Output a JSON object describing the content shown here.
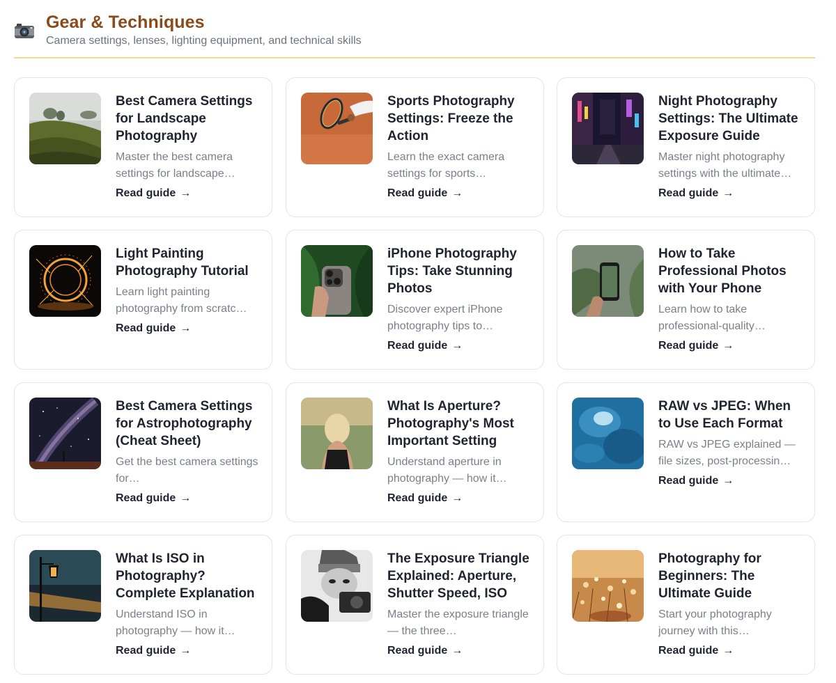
{
  "header": {
    "icon": "camera-icon",
    "title": "Gear & Techniques",
    "subtitle": "Camera settings, lenses, lighting equipment, and technical skills"
  },
  "cards": [
    {
      "title": "Best Camera Settings for Landscape Photography",
      "description": "Master the best camera settings for landscape…",
      "link": "Read guide",
      "image": "misty green hillside landscape"
    },
    {
      "title": "Sports Photography Settings: Freeze the Action",
      "description": "Learn the exact camera settings for sports…",
      "link": "Read guide",
      "image": "tennis racket on clay court"
    },
    {
      "title": "Night Photography Settings: The Ultimate Exposure Guide",
      "description": "Master night photography settings with the ultimate…",
      "link": "Read guide",
      "image": "neon city street at night"
    },
    {
      "title": "Light Painting Photography Tutorial",
      "description": "Learn light painting photography from scratc…",
      "link": "Read guide",
      "image": "steel wool light painting circle"
    },
    {
      "title": "iPhone Photography Tips: Take Stunning Photos",
      "description": "Discover expert iPhone photography tips to…",
      "link": "Read guide",
      "image": "hand holding iPhone among leaves"
    },
    {
      "title": "How to Take Professional Photos with Your Phone",
      "description": "Learn how to take professional-quality…",
      "link": "Read guide",
      "image": "phone photographing plants"
    },
    {
      "title": "Best Camera Settings for Astrophotography (Cheat Sheet)",
      "description": "Get the best camera settings for…",
      "link": "Read guide",
      "image": "milky way over silhouette"
    },
    {
      "title": "What Is Aperture? Photography's Most Important Setting",
      "description": "Understand aperture in photography — how it…",
      "link": "Read guide",
      "image": "woman with blonde hair outdoors"
    },
    {
      "title": "RAW vs JPEG: When to Use Each Format",
      "description": "RAW vs JPEG explained — file sizes, post-processin…",
      "link": "Read guide",
      "image": "blue ice texture"
    },
    {
      "title": "What Is ISO in Photography? Complete Explanation",
      "description": "Understand ISO in photography — how it…",
      "link": "Read guide",
      "image": "street lamp at dusk"
    },
    {
      "title": "The Exposure Triangle Explained: Aperture, Shutter Speed, ISO",
      "description": "Master the exposure triangle — the three…",
      "link": "Read guide",
      "image": "black and white photographer with camera"
    },
    {
      "title": "Photography for Beginners: The Ultimate Guide",
      "description": "Start your photography journey with this…",
      "link": "Read guide",
      "image": "golden wildflowers"
    }
  ]
}
